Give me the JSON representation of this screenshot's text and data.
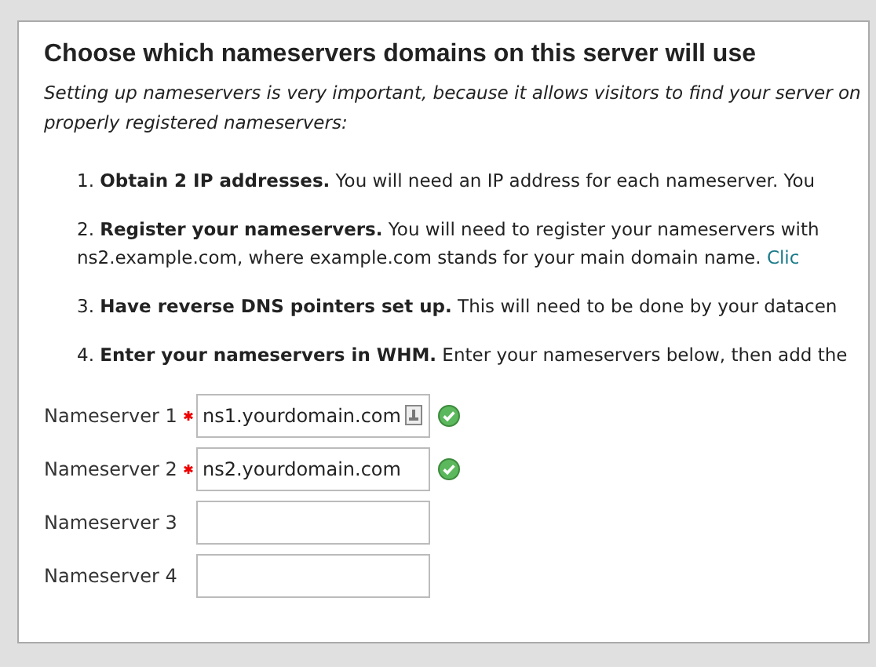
{
  "title": "Choose which nameservers domains on this server will use",
  "intro": [
    "Setting up nameservers is very important, because it allows visitors to find your server on",
    "properly registered nameservers:"
  ],
  "steps": [
    {
      "lines": [
        "1. **Obtain 2 IP addresses.** You will need an IP address for each nameserver. You"
      ]
    },
    {
      "lines": [
        "2. **Register your nameservers.** You will need to register your nameservers with",
        "ns2.example.com, where example.com stands for your main domain name."
      ],
      "link": "Clic"
    },
    {
      "lines": [
        "3. **Have reverse DNS pointers set up.** This will need to be done by your datacen"
      ]
    },
    {
      "lines": [
        "4. **Enter your nameservers in WHM.** Enter your nameservers below, then add the"
      ]
    }
  ],
  "fields": [
    {
      "label": "Nameserver 1",
      "required": true,
      "value": "ns1.yourdomain.com",
      "autofill_icon": true,
      "valid": true
    },
    {
      "label": "Nameserver 2",
      "required": true,
      "value": "ns2.yourdomain.com",
      "autofill_icon": false,
      "valid": true
    },
    {
      "label": "Nameserver 3",
      "required": false,
      "autofill_icon": false,
      "valid": false
    },
    {
      "label": "Nameserver 4",
      "required": false,
      "autofill_icon": false,
      "valid": false
    }
  ]
}
